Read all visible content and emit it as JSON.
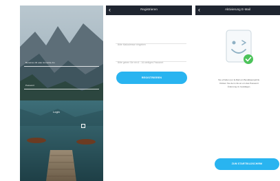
{
  "login": {
    "username_placeholder": "Benutzer-ID oder Anmelde-Ko",
    "password_placeholder": "Passwort",
    "login_label": "Login",
    "button_icon": "square-arrow-icon"
  },
  "register": {
    "back_icon": "chevron-left-icon",
    "title": "Registrieren",
    "email_placeholder": "Bitte Mailadresse eingeben",
    "password_placeholder": "Bitte geben Sie ein 6 - 16-stelliges Passwort",
    "submit_label": "REGISTRIEREN"
  },
  "activation": {
    "back_icon": "chevron-left-icon",
    "title": "Aktivierung E-Mail",
    "illustration_icon": "envelope-smiley-check-icon",
    "message_lines": [
      "Sie erhalten per E-Mail ein Bestätigungslink.",
      "Klicken Sie den Link an um das Passwort",
      "Änderung zu bestätigen."
    ],
    "start_label": "ZUM STARTBILDSCHIRM"
  },
  "colors": {
    "accent": "#29b4f0",
    "header": "#1f2530",
    "check": "#4cc35a"
  }
}
